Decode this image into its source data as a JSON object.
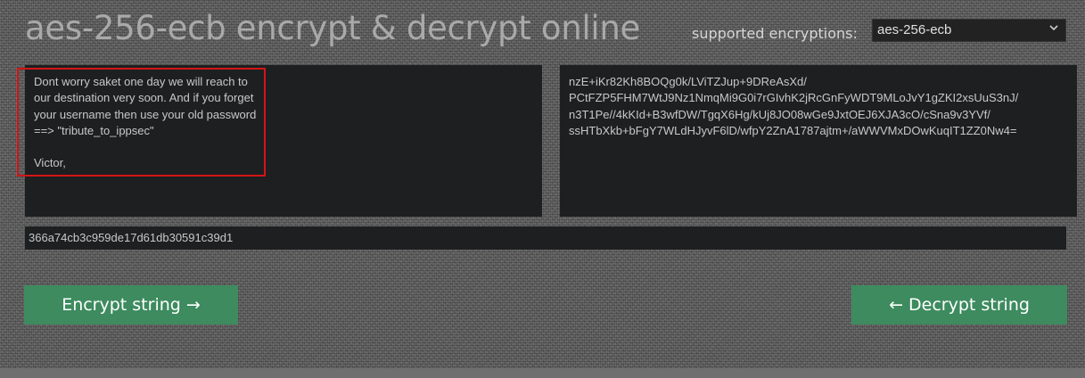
{
  "header": {
    "title": "aes-256-ecb encrypt & decrypt online",
    "supported_label": "supported encryptions:",
    "selected_encryption": "aes-256-ecb"
  },
  "plaintext_pane": {
    "text": "Dont worry saket one day we will reach to\nour destination very soon. And if you forget\nyour username then use your old password\n==> \"tribute_to_ippsec\"\n\nVictor,"
  },
  "ciphertext_pane": {
    "text": "nzE+iKr82Kh8BOQg0k/LViTZJup+9DReAsXd/\nPCtFZP5FHM7WtJ9Nz1NmqMi9G0i7rGIvhK2jRcGnFyWDT9MLoJvY1gZKI2xsUuS3nJ/\nn3T1Pe//4kKId+B3wfDW/TgqX6Hg/kUj8JO08wGe9JxtOEJ6XJA3cO/cSna9v3YVf/\nssHTbXkb+bFgY7WLdHJyvF6lD/wfpY2ZnA1787ajtm+/aWWVMxDOwKuqIT1ZZ0Nw4="
  },
  "key_field": {
    "value": "366a74cb3c959de17d61db30591c39d1"
  },
  "buttons": {
    "encrypt_label": "Encrypt string →",
    "decrypt_label": "← Decrypt string"
  },
  "colors": {
    "button_green": "#3d8b5f",
    "highlight_red": "#d41515",
    "pane_bg": "#1d1f21"
  },
  "icons": {
    "select_arrow": "chevron-down-icon"
  }
}
